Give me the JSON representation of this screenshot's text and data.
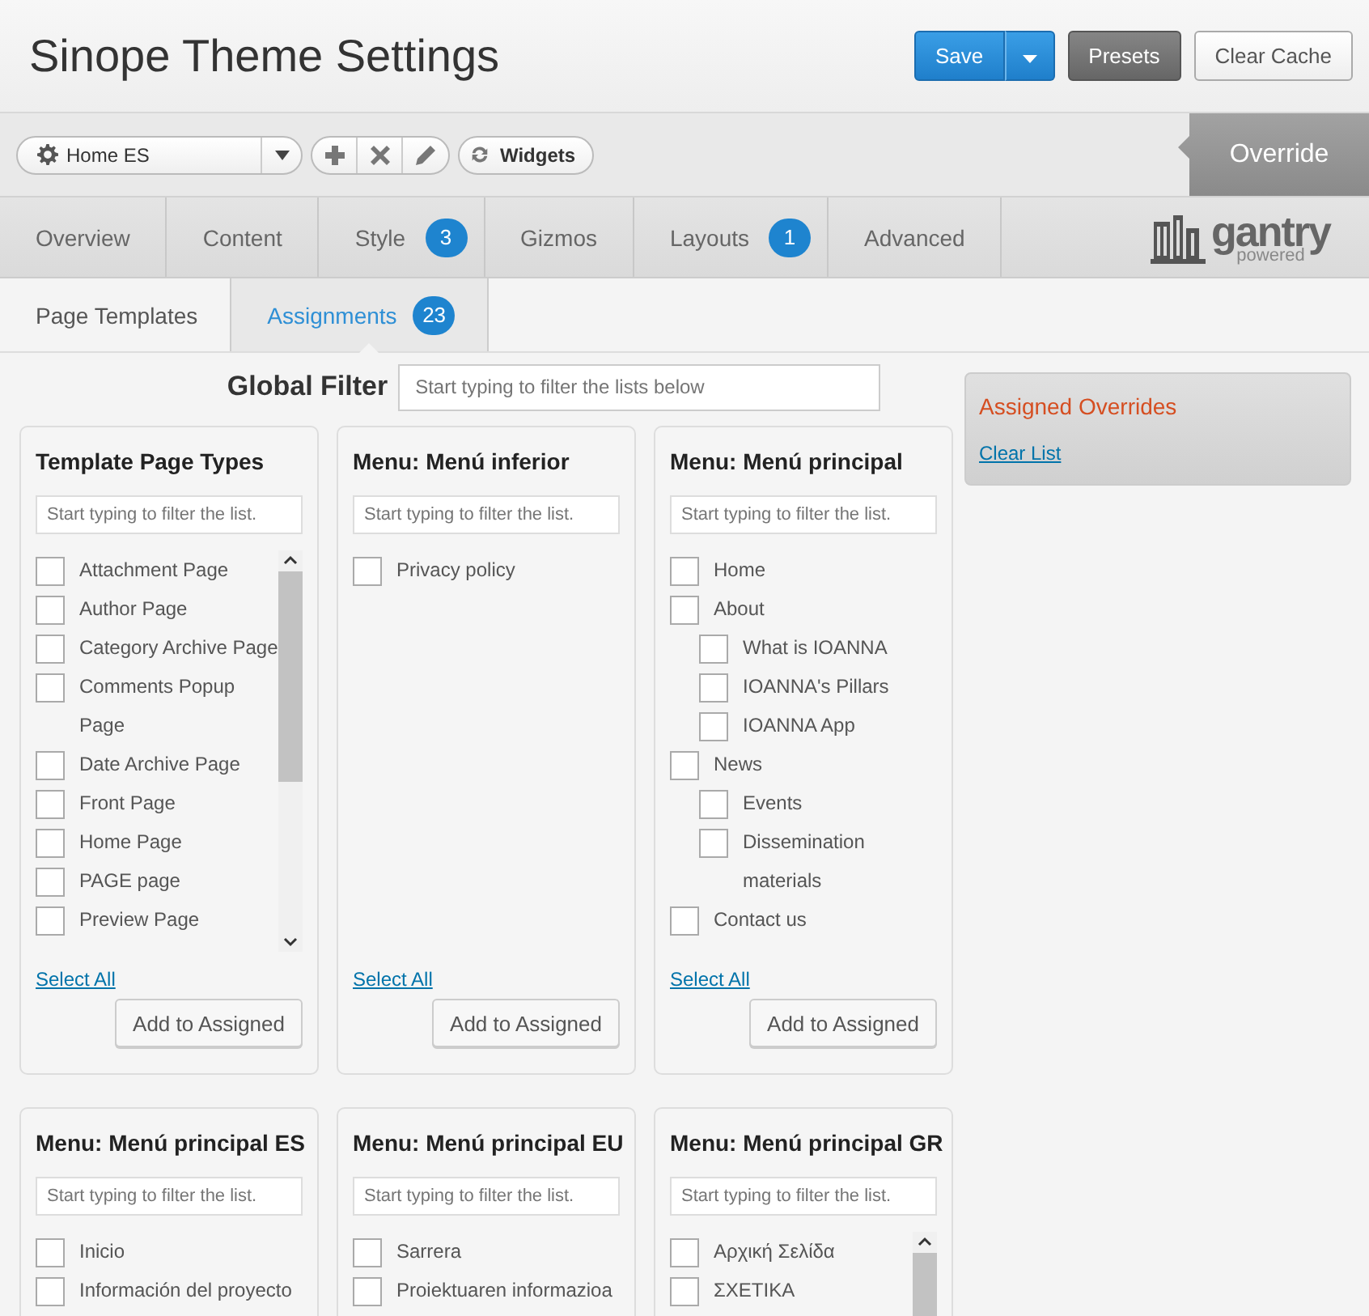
{
  "header": {
    "title": "Sinope Theme Settings",
    "buttons": [
      {
        "label": "Save",
        "kind": "primary"
      },
      {
        "label": "Presets",
        "kind": "dark"
      },
      {
        "label": "Clear Cache",
        "kind": "plain"
      }
    ]
  },
  "toolbar": {
    "override_select": {
      "value": "Home ES"
    },
    "widgets_button": "Widgets",
    "override_label": "Override"
  },
  "tabs": [
    {
      "label": "Overview",
      "selected": false
    },
    {
      "label": "Content",
      "selected": false
    },
    {
      "label": "Style",
      "badge": "3",
      "selected": false
    },
    {
      "label": "Gizmos",
      "selected": false
    },
    {
      "label": "Layouts",
      "badge": "1",
      "selected": false
    },
    {
      "label": "Advanced",
      "selected": false
    }
  ],
  "logo": {
    "name": "gantry",
    "tagline": "powered"
  },
  "subtabs": [
    {
      "label": "Page Templates",
      "selected": false
    },
    {
      "label": "Assignments",
      "badge": "23",
      "selected": true
    }
  ],
  "global_filter": {
    "label": "Global Filter",
    "placeholder": "Start typing to filter the lists below"
  },
  "cards": [
    {
      "title": "Template Page Types",
      "placeholder": "Start typing to filter the list.",
      "scrollable": true,
      "items": [
        {
          "label": "Attachment Page",
          "checked": false
        },
        {
          "label": "Author Page",
          "checked": false
        },
        {
          "label": "Category Archive Page",
          "checked": false
        },
        {
          "label": "Comments Popup Page",
          "checked": false
        },
        {
          "label": "Date Archive Page",
          "checked": false
        },
        {
          "label": "Front Page",
          "checked": false
        },
        {
          "label": "Home Page",
          "checked": false
        },
        {
          "label": "PAGE page",
          "checked": false
        },
        {
          "label": "Preview Page",
          "checked": false
        }
      ],
      "select_all": "Select All",
      "add_button": "Add to Assigned"
    },
    {
      "title": "Menu: Menú inferior",
      "placeholder": "Start typing to filter the list.",
      "scrollable": false,
      "items": [
        {
          "label": "Privacy policy",
          "checked": false
        }
      ],
      "select_all": "Select All",
      "add_button": "Add to Assigned"
    },
    {
      "title": "Menu: Menú principal",
      "placeholder": "Start typing to filter the list.",
      "scrollable": false,
      "items": [
        {
          "label": "Home",
          "checked": false
        },
        {
          "label": "About",
          "checked": false,
          "children": [
            {
              "label": "What is IOANNA",
              "checked": false
            },
            {
              "label": "IOANNA's Pillars",
              "checked": false
            },
            {
              "label": "IOANNA App",
              "checked": false
            }
          ]
        },
        {
          "label": "News",
          "checked": false,
          "children": [
            {
              "label": "Events",
              "checked": false
            },
            {
              "label": "Dissemination materials",
              "checked": false
            }
          ]
        },
        {
          "label": "Contact us",
          "checked": false
        }
      ],
      "select_all": "Select All",
      "add_button": "Add to Assigned"
    },
    {
      "title": "Menu: Menú principal ES",
      "placeholder": "Start typing to filter the list.",
      "scrollable": false,
      "items": [
        {
          "label": "Inicio",
          "checked": false
        },
        {
          "label": "Información del proyecto",
          "checked": false
        }
      ]
    },
    {
      "title": "Menu: Menú principal EU",
      "placeholder": "Start typing to filter the list.",
      "scrollable": false,
      "items": [
        {
          "label": "Sarrera",
          "checked": false
        },
        {
          "label": "Proiektuaren informazioa",
          "checked": false
        }
      ]
    },
    {
      "title": "Menu: Menú principal GR",
      "placeholder": "Start typing to filter the list.",
      "scrollable": true,
      "items": [
        {
          "label": "Αρχική Σελίδα",
          "checked": false
        },
        {
          "label": "ΣΧΕΤΙΚΑ",
          "checked": false
        }
      ]
    }
  ],
  "assigned_panel": {
    "title": "Assigned Overrides",
    "link": "Clear List"
  }
}
